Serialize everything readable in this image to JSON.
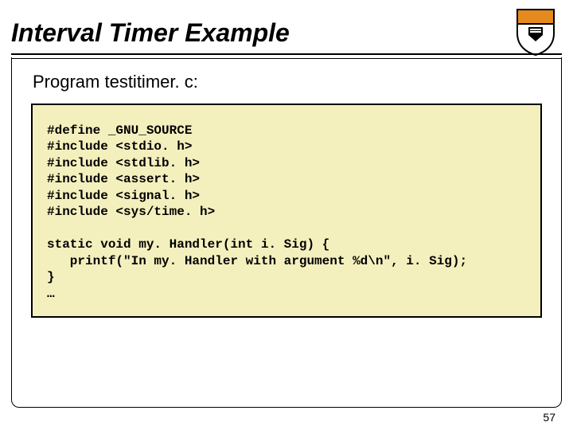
{
  "slide": {
    "title": "Interval Timer Example",
    "subhead": "Program testitimer. c:",
    "page_number": "57",
    "logo_name": "princeton-shield"
  },
  "code": {
    "l1": "#define _GNU_SOURCE",
    "l2": "#include <stdio. h>",
    "l3": "#include <stdlib. h>",
    "l4": "#include <assert. h>",
    "l5": "#include <signal. h>",
    "l6": "#include <sys/time. h>",
    "l7": "",
    "l8": "static void my. Handler(int i. Sig) {",
    "l9": "   printf(\"In my. Handler with argument %d\\n\", i. Sig);",
    "l10": "}",
    "l11": "…"
  }
}
